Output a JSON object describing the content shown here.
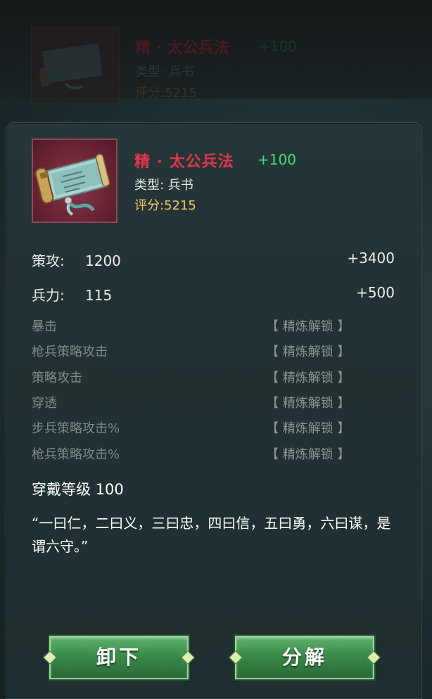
{
  "background_item": {
    "name": "精 · 太公兵法",
    "bonus": "+100",
    "type": "类型: 兵书",
    "score": "评分:5215"
  },
  "item": {
    "icon": "scroll-icon",
    "name": "精 · 太公兵法",
    "bonus": "+100",
    "type": "类型: 兵书",
    "score": "评分:5215",
    "colors": {
      "name": "#e0354f",
      "bonus": "#3de07a",
      "score": "#efc566"
    }
  },
  "stats": [
    {
      "label": "策攻:",
      "value": "1200",
      "bonus": "+3400"
    },
    {
      "label": "兵力:",
      "value": "115",
      "bonus": "+500"
    }
  ],
  "locked_stats": [
    {
      "name": "暴击",
      "status": "【 精炼解锁 】"
    },
    {
      "name": "枪兵策略攻击",
      "status": "【 精炼解锁 】"
    },
    {
      "name": "策略攻击",
      "status": "【 精炼解锁 】"
    },
    {
      "name": "穿透",
      "status": "【 精炼解锁 】"
    },
    {
      "name": "步兵策略攻击%",
      "status": "【 精炼解锁 】"
    },
    {
      "name": "枪兵策略攻击%",
      "status": "【 精炼解锁 】"
    }
  ],
  "requirement": "穿戴等级  100",
  "quote": "“一曰仁，二曰义，三曰忠，四曰信，五曰勇，六曰谋，是谓六守。”",
  "buttons": {
    "unequip": "卸下",
    "decompose": "分解"
  }
}
